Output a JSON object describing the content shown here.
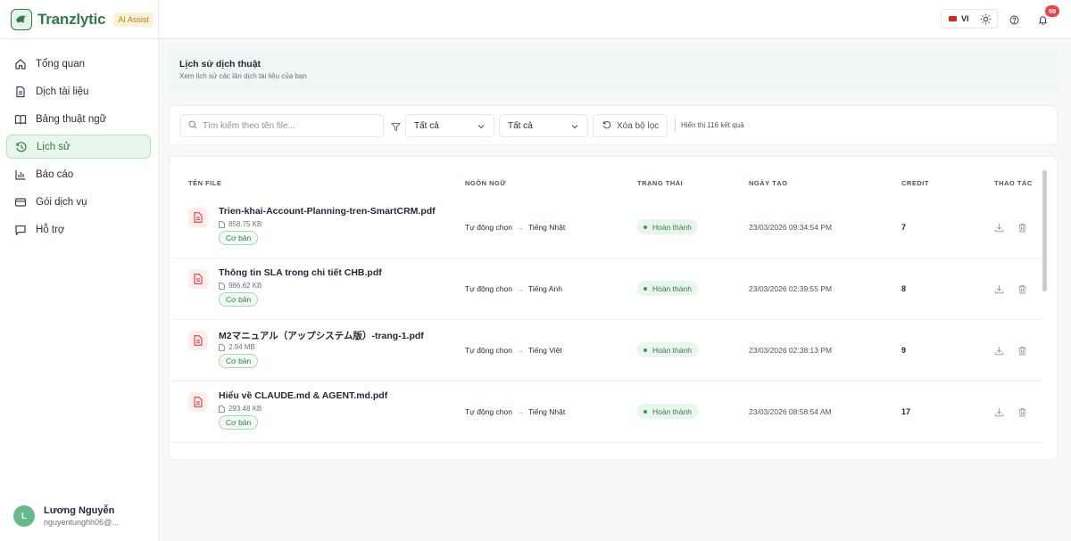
{
  "brand": {
    "name": "Tranzlytic",
    "badge": "AI Assist"
  },
  "sidebar": {
    "items": [
      {
        "label": "Tổng quan",
        "icon": "home-icon"
      },
      {
        "label": "Dịch tài liệu",
        "icon": "document-icon"
      },
      {
        "label": "Bảng thuật ngữ",
        "icon": "book-icon"
      },
      {
        "label": "Lịch sử",
        "icon": "history-icon",
        "active": true
      },
      {
        "label": "Báo cáo",
        "icon": "bar-chart-icon"
      },
      {
        "label": "Gói dịch vụ",
        "icon": "credit-card-icon"
      },
      {
        "label": "Hỗ trợ",
        "icon": "chat-icon"
      }
    ]
  },
  "user": {
    "initial": "L",
    "name": "Lương Nguyễn",
    "email": "nguyentunghh06@..."
  },
  "header": {
    "language": "VI",
    "notification_count": "59"
  },
  "page": {
    "title": "Lịch sử dịch thuật",
    "subtitle": "Xem lịch sử các lần dịch tài liệu của bạn"
  },
  "filters": {
    "search_placeholder": "Tìm kiếm theo tên file...",
    "select_1": "Tất cả",
    "select_2": "Tất cả",
    "clear_label": "Xóa bộ lọc",
    "result_text": "Hiển thị 116 kết quả"
  },
  "table": {
    "headers": {
      "file": "TÊN FILE",
      "language": "NGÔN NGỮ",
      "status": "TRẠNG THÁI",
      "date": "NGÀY TẠO",
      "credit": "CREDIT",
      "actions": "THAO TÁC"
    },
    "rows": [
      {
        "name": "Trien-khai-Account-Planning-tren-SmartCRM.pdf",
        "size": "858.75 KB",
        "plan": "Cơ bản",
        "source": "Tự động chọn",
        "target": "Tiếng Nhật",
        "status": "Hoàn thành",
        "date": "23/03/2026 09:34:54 PM",
        "credit": "7"
      },
      {
        "name": "Thông tin SLA trong chi tiết CHB.pdf",
        "size": "986.62 KB",
        "plan": "Cơ bản",
        "source": "Tự động chọn",
        "target": "Tiếng Anh",
        "status": "Hoàn thành",
        "date": "23/03/2026 02:39:55 PM",
        "credit": "8"
      },
      {
        "name": "M2マニュアル（アップシステム版）-trang-1.pdf",
        "size": "2.94 MB",
        "plan": "Cơ bản",
        "source": "Tự động chọn",
        "target": "Tiếng Việt",
        "status": "Hoàn thành",
        "date": "23/03/2026 02:38:13 PM",
        "credit": "9"
      },
      {
        "name": "Hiểu về CLAUDE.md & AGENT.md.pdf",
        "size": "293.48 KB",
        "plan": "Cơ bản",
        "source": "Tự động chọn",
        "target": "Tiếng Nhật",
        "status": "Hoàn thành",
        "date": "23/03/2026 08:58:54 AM",
        "credit": "17"
      }
    ]
  },
  "colors": {
    "brand_green": "#2e7d46",
    "notification_red": "#ef4444"
  }
}
